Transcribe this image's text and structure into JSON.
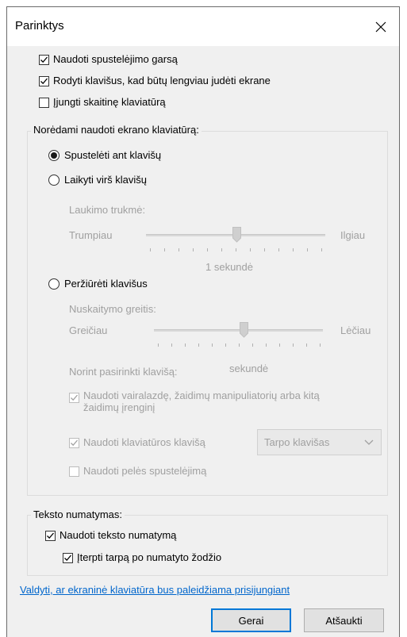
{
  "window": {
    "title": "Parinktys"
  },
  "options": [
    {
      "label": "Naudoti spustelėjimo garsą",
      "checked": true
    },
    {
      "label": "Rodyti klavišus, kad būtų lengviau judėti ekrane",
      "checked": true
    },
    {
      "label": "Įjungti skaitinę klaviatūrą",
      "checked": false
    }
  ],
  "keyboard_group": {
    "legend": "Norėdami naudoti ekrano klaviatūrą:",
    "mode_click": "Spustelėti ant klavišų",
    "mode_hover": "Laikyti virš klavišų",
    "hover_duration_label": "Laukimo trukmė:",
    "hover_min": "Trumpiau",
    "hover_max": "Ilgiau",
    "hover_value": "1 sekundė",
    "mode_scan": "Peržiūrėti klavišus",
    "scan_speed_label": "Nuskaitymo greitis:",
    "scan_min": "Greičiau",
    "scan_max": "Lėčiau",
    "scan_select_label": "Norint pasirinkti klavišą:",
    "scan_value": "sekundė",
    "use_joystick_line1": "Naudoti vairalazdę, žaidimų manipuliatorių arba kitą",
    "use_joystick_line2": "žaidimų įrenginį",
    "use_keyboard_key": "Naudoti klaviatūros klavišą",
    "key_select_value": "Tarpo klavišas",
    "use_mouse_click": "Naudoti pelės spustelėjimą",
    "selected_mode": "Spustelėti ant klavišų"
  },
  "prediction_group": {
    "legend": "Teksto numatymas:",
    "use_prediction": "Naudoti teksto numatymą",
    "insert_space": "Įterpti tarpą po numatyto žodžio"
  },
  "footer": {
    "link": "Valdyti, ar ekraninė klaviatūra bus paleidžiama prisijungiant",
    "ok": "Gerai",
    "cancel": "Atšaukti"
  },
  "colors": {
    "accent": "#0078d7",
    "link": "#0066cc",
    "disabled_text": "#a0a0a0"
  }
}
